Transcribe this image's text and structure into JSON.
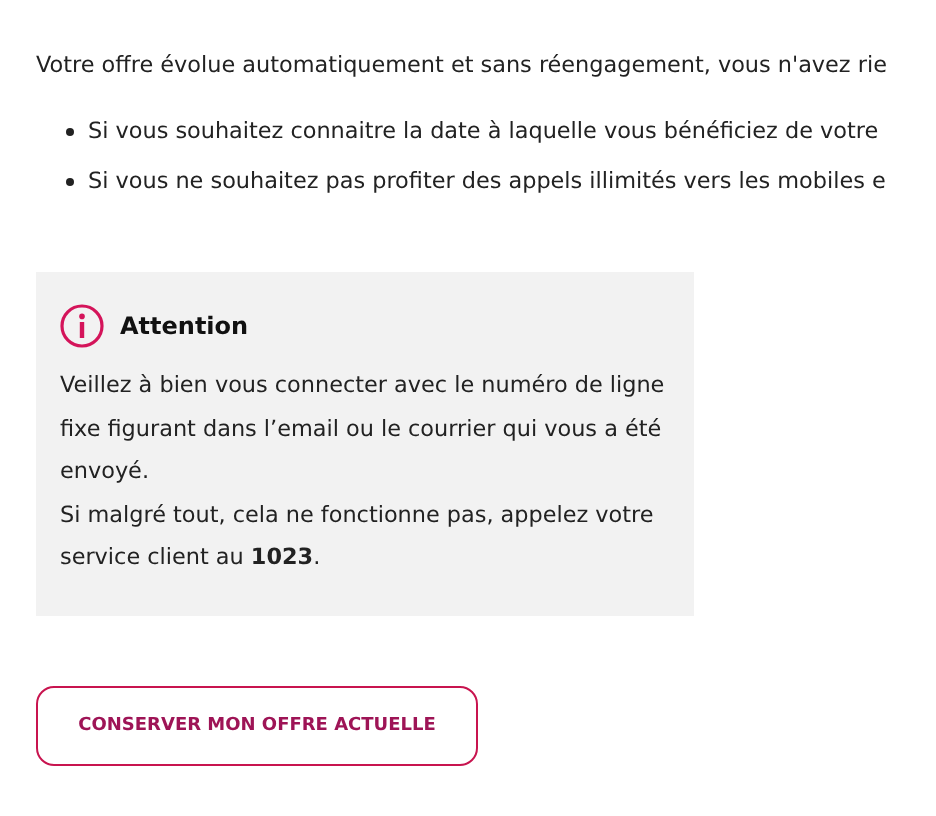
{
  "intro": "Votre offre évolue automatiquement et sans réengagement, vous n'avez rie",
  "bullets": [
    "Si vous souhaitez connaitre la date à laquelle vous bénéficiez de votre",
    "Si vous ne souhaitez pas profiter des appels illimités vers les mobiles e"
  ],
  "notice": {
    "title": "Attention",
    "body": "Veillez à bien vous connecter avec le numéro de ligne fixe figurant dans l’email ou le courrier qui vous a été envoyé.",
    "body_2": "Si malgré tout, cela ne fonctionne pas, appelez votre service client au **1023**."
  },
  "button": "CONSERVER MON OFFRE ACTUELLE"
}
